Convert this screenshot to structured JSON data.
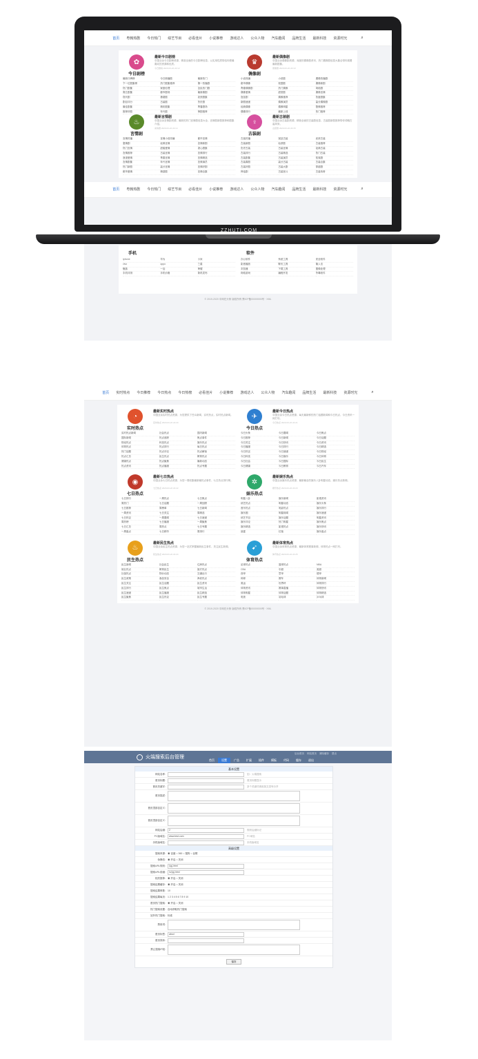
{
  "brand": "ZZHUTI.COM",
  "nav1": [
    "首页",
    "粤韩热剧",
    "今日热门",
    "综艺节目",
    "必看佳片",
    "小说推荐",
    "游戏达人",
    "公众人物",
    "汽车趣闻",
    "品牌生活",
    "最新科技",
    "资源时光"
  ],
  "nav2": [
    "首页",
    "实时热点",
    "今日推荐",
    "今日热点",
    "今日热榜",
    "必看佳片",
    "小说推荐",
    "游戏达人",
    "公众人物",
    "汽车趣闻",
    "品牌生活",
    "最新科技",
    "资源时光"
  ],
  "screen_blocks": [
    {
      "logo": "今日剧榜",
      "title": "最新今日剧榜",
      "color": "#d94b8c",
      "glyph": "✿",
      "desc": "中国业余今日剧榜资源，精准全面的今日剧榜信息，以实用性质带给你受最喜欢的资源和优质。",
      "meta": "今日剧榜  2020-03-22 22:12",
      "items": [
        "最新口碑榜",
        "今日新播剧",
        "最新热门",
        "下一位剧集榜",
        "热门剧集推荐",
        "第一热播剧",
        "热门剧集",
        "家庭伦理",
        "全民热门剧",
        "周五剧集",
        "都市剧场",
        "最新喜剧",
        "现代剧",
        "悬疑剧",
        "武侠剧集",
        "剧目评分",
        "古装剧",
        "历史剧",
        "最佳剧集",
        "精彩剧集",
        "青春剧场",
        "推荐好剧",
        "年代剧",
        "神剧推荐"
      ]
    },
    {
      "logo": "偶像剧",
      "title": "最新偶像剧",
      "color": "#b93a2f",
      "glyph": "♛",
      "desc": "中国业余偶像剧资源，深度的偶像剧资讯，热门偶像剧信息大集合带你观看最新剧集。",
      "meta": "偶像剧  2020-03-22 22:13",
      "items": [
        "小说改编",
        "小说剧",
        "偶像热播剧",
        "都市偶像",
        "校园剧",
        "偶像新剧",
        "青春偶像剧",
        "热门偶像",
        "网络剧",
        "偶像爱情",
        "甜宠剧",
        "偶像言情",
        "宫廷剧",
        "偶像推荐",
        "热度剧集",
        "新剧速递",
        "偶像演员",
        "高分偶像剧",
        "经典偶像",
        "偶像明星",
        "剧情推荐",
        "偶像排行",
        "最新上线",
        "热门推荐"
      ]
    },
    {
      "logo": "言情剧",
      "title": "最新言情剧",
      "color": "#5a8a2a",
      "glyph": "♨",
      "desc": "中国业余言情剧资源，最新的热门言情剧信息大全，言情剧新剧推荐和剧集介绍。",
      "meta": "言情剧  2020-03-22 22:14",
      "items": [
        "言情热播",
        "言情小说改编",
        "都市言情",
        "爱情剧",
        "经典言情",
        "言情新剧",
        "热门言情",
        "甜蜜爱情",
        "虐心剧集",
        "言情推荐",
        "古装言情",
        "言情排行",
        "浪漫爱情",
        "青春言情",
        "言情精选",
        "言情剧集",
        "年代言情",
        "言情演员",
        "热门新剧",
        "高分言情",
        "言情好剧",
        "都市爱情",
        "情感剧",
        "言情合集"
      ]
    },
    {
      "logo": "古装剧",
      "title": "最新古装剧",
      "color": "#d64f9e",
      "glyph": "♀",
      "desc": "中国业余古装剧资源，精致全面的古装剧信息，古装剧新剧推荐带你领略古装风采。",
      "meta": "古装剧  2020-03-22 22:15",
      "items": [
        "古装热播",
        "宫廷古装",
        "武侠古装",
        "古装新剧",
        "仙侠剧",
        "古装推荐",
        "历史古装",
        "古装言情",
        "经典古装",
        "古装排行",
        "古装精选",
        "热门古装",
        "古装剧集",
        "古装演员",
        "权谋剧",
        "古装喜剧",
        "高分古装",
        "古装合集",
        "古装好剧",
        "古装大剧",
        "穿越剧",
        "神话剧",
        "古装宫斗",
        "古装传奇"
      ]
    }
  ],
  "scroll_blocks": [
    {
      "logo": "手机",
      "items": [
        "iphone",
        "华为",
        "小米",
        "vivo",
        "oppo",
        "三星",
        "魅族",
        "一加",
        "荣耀",
        "手机评测",
        "手机价格",
        "新机发布"
      ]
    },
    {
      "logo": "软件",
      "items": [
        "办公软件",
        "系统工具",
        "安全软件",
        "影音播放",
        "聊天工具",
        "输入法",
        "浏览器",
        "下载工具",
        "图像处理",
        "网络游戏",
        "编程开发",
        "杀毒软件"
      ]
    }
  ],
  "hot_blocks": [
    {
      "logo": "实时热点",
      "title": "最新实时热点",
      "color": "#e0522d",
      "glyph": "◔",
      "desc": "中国业余实时热点资源，为您提供了任众新闻，实时热点，实时热点新闻。",
      "meta": "实时热点  2020-03-22 22:20",
      "items": [
        "实时热点新闻",
        "社会热点",
        "国内新闻",
        "国际新闻",
        "热点追踪",
        "焦点事件",
        "财经热点",
        "科技热点",
        "娱乐热点",
        "体育热点",
        "热点排行",
        "每日热点",
        "热门话题",
        "热点评论",
        "热点解读",
        "热点汇总",
        "民生热点",
        "教育热点",
        "健康热点",
        "热点聚焦",
        "最新动态",
        "热点资讯",
        "热点播报",
        "热点专题"
      ]
    },
    {
      "logo": "今日热点",
      "title": "最新今日热点",
      "color": "#2f7fd0",
      "glyph": "✈",
      "desc": "中国业余今日热点资源，每天最新鲜的热门话题新闻和今日热点，今日资讯一网打尽。",
      "meta": "今日热点  2020-03-22 22:21",
      "items": [
        "今日头条",
        "今日要闻",
        "今日焦点",
        "今日推荐",
        "今日新闻",
        "今日话题",
        "今日关注",
        "今日快讯",
        "今日资讯",
        "今日播报",
        "今日排行",
        "今日精选",
        "今日热议",
        "今日速递",
        "今日财经",
        "今日科技",
        "今日娱乐",
        "今日体育",
        "今日社会",
        "今日国际",
        "今日民生",
        "今日健康",
        "今日教育",
        "今日汽车"
      ]
    },
    {
      "logo": "七日热点",
      "title": "最新七日热点",
      "color": "#c0392b",
      "glyph": "◉",
      "desc": "中国业余七日热点资源，为您一周收集最新最热点事件，七日热点排行榜。",
      "meta": "七日热点  2020-03-22 22:22",
      "items": [
        "七日排行",
        "一周热点",
        "七日焦点",
        "周热门",
        "七日话题",
        "一周回顾",
        "七日推荐",
        "周榜单",
        "七日新闻",
        "一周资讯",
        "七日关注",
        "周精选",
        "七日热议",
        "一周要闻",
        "七日速递",
        "周热榜",
        "七日播报",
        "一周聚焦",
        "七日汇总",
        "周热点",
        "七日专题",
        "一周盘点",
        "七日精华",
        "周排行"
      ]
    },
    {
      "logo": "娱乐热点",
      "title": "最新娱乐热点",
      "color": "#2ea86a",
      "glyph": "✲",
      "desc": "中国业余娱乐热点资源，最新最全的娱乐八卦明星动态，娱乐热点新闻。",
      "meta": "娱乐热点  2020-03-22 22:23",
      "items": [
        "明星八卦",
        "娱乐新闻",
        "影视资讯",
        "综艺热点",
        "明星动态",
        "娱乐头条",
        "音乐热点",
        "电影热点",
        "娱乐排行",
        "娱乐圈",
        "明星绯闻",
        "娱乐速递",
        "综艺节目",
        "娱乐话题",
        "明星资讯",
        "娱乐评论",
        "热门明星",
        "娱乐焦点",
        "娱乐精选",
        "影视热点",
        "娱乐快讯",
        "追星",
        "红毯",
        "娱乐盘点"
      ]
    },
    {
      "logo": "民生热点",
      "title": "最新民生热点",
      "color": "#e8a01c",
      "glyph": "♨",
      "desc": "中国业余民生热点资源，为您一站式掌握最新民生事件，关注民生新闻。",
      "meta": "民生热点  2020-03-22 22:24",
      "items": [
        "民生新闻",
        "社会民生",
        "住房热点",
        "就业热点",
        "教育民生",
        "医疗热点",
        "社保热点",
        "物价动态",
        "交通出行",
        "民生政策",
        "食品安全",
        "养老热点",
        "民生关注",
        "民生话题",
        "民生资讯",
        "民生排行",
        "民生焦点",
        "城市生活",
        "民生速递",
        "民生播报",
        "民生精选",
        "民生聚焦",
        "民生热议",
        "民生专题"
      ]
    },
    {
      "logo": "体育热点",
      "title": "最新体育热点",
      "color": "#2a9fd6",
      "glyph": "➹",
      "desc": "中国业余体育热点资源，最新体育赛事新闻，体育热点一网打尽。",
      "meta": "体育热点  2020-03-22 22:25",
      "items": [
        "足球热点",
        "篮球热点",
        "NBA",
        "CBA",
        "中超",
        "英超",
        "西甲",
        "意甲",
        "德甲",
        "网球",
        "赛车",
        "体育新闻",
        "奥运",
        "世界杯",
        "体育排行",
        "体育资讯",
        "赛事直播",
        "体育快讯",
        "体育明星",
        "体育话题",
        "体育精选",
        "电竞",
        "羽毛球",
        "乒乓球"
      ]
    }
  ],
  "footer_text": "© 2019-2020 中网在头条 版权所有 豫ICP备00000000号 · XML",
  "admin": {
    "brand": "火端搜索后台管理",
    "menu": [
      "首页",
      "设置",
      "广告",
      "扩展",
      "插件",
      "模板",
      "代码",
      "缓存",
      "退出"
    ],
    "top_links": [
      "后台首页",
      "网站首页",
      "清除缓存",
      "退出"
    ],
    "section1": "基本设置",
    "section2": "高级设置",
    "rows": [
      {
        "label": "网站名称:",
        "value": "",
        "hint": "如：火端搜索"
      },
      {
        "label": "首页标题:",
        "value": "",
        "hint": "首页标题显示"
      },
      {
        "label": "首页关键字:",
        "value": "",
        "hint": "多个关键词请用英文逗号分开"
      },
      {
        "label": "首页描述:",
        "type": "textarea"
      },
      {
        "label": "首页顶部自定义:",
        "type": "textarea"
      },
      {
        "label": "首页顶部自定义:",
        "type": "textarea"
      },
      {
        "label": "网站后缀:",
        "value": "2",
        "hint": "规则后缀标记"
      },
      {
        "label": "PC版域名:",
        "value": "www.test.com",
        "hint": "PC域名"
      },
      {
        "label": "手机版域名:",
        "value": "",
        "hint": "手机版域名"
      }
    ],
    "rows2": [
      {
        "label": "搜索来源:",
        "text": "◉ 百度 ○ 360 ○ 搜狗 ○ 谷歌"
      },
      {
        "label": "伪静态:",
        "text": "◉ 开启 ○ 关闭"
      },
      {
        "label": "搜索URL规则:",
        "value": "/{q}.html"
      },
      {
        "label": "搜索URL前缀:",
        "value": "/s/{q}.html"
      },
      {
        "label": "相关推荐:",
        "text": "◉ 开启 ○ 关闭"
      },
      {
        "label": "搜索结果缓存:",
        "text": "◉ 开启 ○ 关闭"
      },
      {
        "label": "搜索结果条数:",
        "text": "10"
      },
      {
        "label": "搜索结果每页:",
        "text": "1 2 3 4 5 6 7 8 9 10"
      },
      {
        "label": "首页热门搜索:",
        "text": "◉ 开启 ○ 关闭"
      },
      {
        "label": "热门搜索设置:",
        "text": "自动获取热门搜索"
      },
      {
        "label": "站外热门搜索:",
        "text": "标准"
      },
      {
        "label": "禁用词:",
        "type": "textarea"
      },
      {
        "label": "首页标签:",
        "value": "abcd"
      },
      {
        "label": "首页排序:",
        "value": ""
      },
      {
        "label": "禁止搜索IP段:",
        "type": "textarea"
      }
    ],
    "save_label": "保存"
  }
}
